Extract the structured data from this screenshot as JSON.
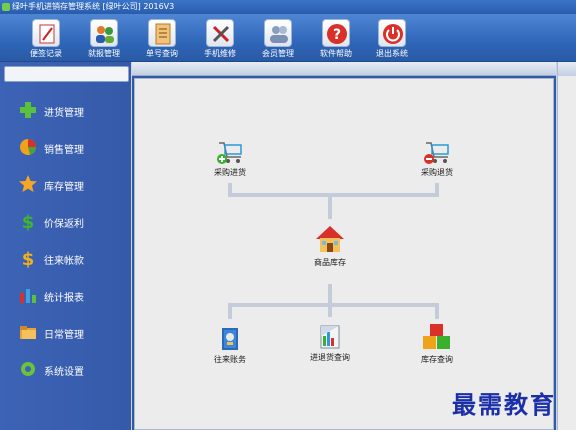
{
  "window": {
    "title": "绿叶手机进销存管理系统 [绿叶公司] 2016V3"
  },
  "toolbar": {
    "buttons": [
      {
        "label": "便签记录",
        "icon": "notepad-icon"
      },
      {
        "label": "就报管理",
        "icon": "people-icon"
      },
      {
        "label": "单号查询",
        "icon": "document-icon"
      },
      {
        "label": "手机维修",
        "icon": "tools-icon"
      },
      {
        "label": "会员管理",
        "icon": "members-icon"
      },
      {
        "label": "软件帮助",
        "icon": "help-icon"
      },
      {
        "label": "退出系统",
        "icon": "power-icon"
      }
    ]
  },
  "sidebar": {
    "items": [
      {
        "label": "进货管理",
        "icon": "plus-icon"
      },
      {
        "label": "销售管理",
        "icon": "pie-icon"
      },
      {
        "label": "库存管理",
        "icon": "star-icon"
      },
      {
        "label": "价保返利",
        "icon": "dollar-icon"
      },
      {
        "label": "往来帐款",
        "icon": "gold-dollar-icon"
      },
      {
        "label": "统计报表",
        "icon": "bar-chart-icon"
      },
      {
        "label": "日常管理",
        "icon": "folder-icon"
      },
      {
        "label": "系统设置",
        "icon": "gear-icon"
      }
    ]
  },
  "flow": {
    "purchase_in": "采购进货",
    "purchase_return": "采购退货",
    "inventory": "商品库存",
    "accounts": "往来账务",
    "in_out_query": "进退货查询",
    "stock_query": "库存查询"
  },
  "watermark": {
    "text": "最需教育"
  },
  "colors": {
    "toolbar": "#2f66b8",
    "sidebar": "#3d63b6",
    "canvas": "#ececec",
    "watermark": "#1a2fa8"
  }
}
